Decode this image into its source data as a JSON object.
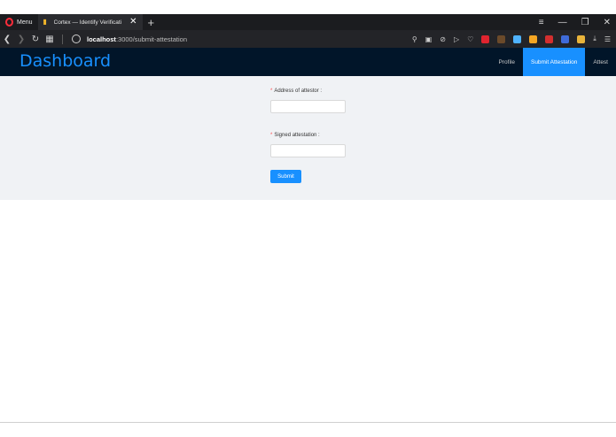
{
  "browser": {
    "menu_label": "Menu",
    "tab_title": "Cortex — Identify Verificati",
    "new_tab_symbol": "+",
    "url_host": "localhost",
    "url_rest": ":3000/submit-attestation"
  },
  "app": {
    "brand": "Dashboard",
    "nav": [
      {
        "label": "Profile",
        "active": false
      },
      {
        "label": "Submit Attestation",
        "active": true
      },
      {
        "label": "Attest",
        "active": false
      }
    ]
  },
  "form": {
    "address_label": "Address of attestor",
    "address_value": "",
    "signed_label": "Signed attestation",
    "signed_value": "",
    "submit_label": "Submit",
    "required_marker": "*"
  },
  "colors": {
    "accent": "#1890ff",
    "header_bg": "#011529",
    "content_bg": "#f0f2f5"
  }
}
